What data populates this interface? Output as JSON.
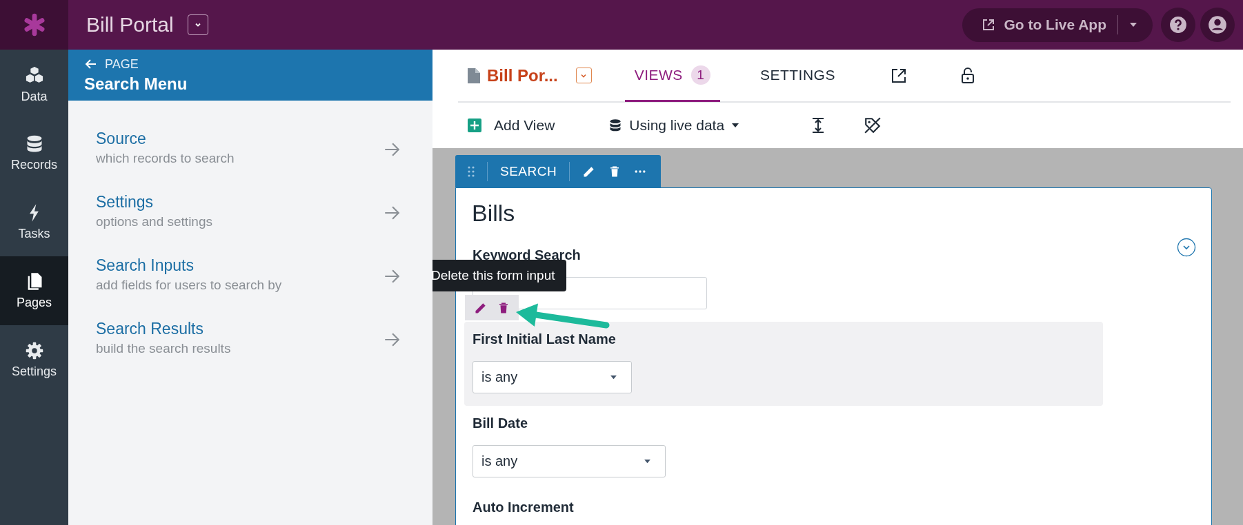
{
  "app": {
    "title": "Bill Portal",
    "live_app_button": "Go to Live App"
  },
  "nav_rail": [
    {
      "label": "Data",
      "kind": "cubes",
      "selected": false
    },
    {
      "label": "Records",
      "kind": "database",
      "selected": false
    },
    {
      "label": "Tasks",
      "kind": "bolt",
      "selected": false
    },
    {
      "label": "Pages",
      "kind": "pages",
      "selected": true
    },
    {
      "label": "Settings",
      "kind": "gear",
      "selected": false
    }
  ],
  "panel": {
    "back_label": "PAGE",
    "title": "Search Menu",
    "items": [
      {
        "title": "Source",
        "subtitle": "which records to search"
      },
      {
        "title": "Settings",
        "subtitle": "options and settings"
      },
      {
        "title": "Search Inputs",
        "subtitle": "add fields for users to search by"
      },
      {
        "title": "Search Results",
        "subtitle": "build the search results"
      }
    ]
  },
  "page_tabs": {
    "page_name": "Bill Por...",
    "tabs": [
      {
        "label": "VIEWS",
        "badge": "1",
        "selected": true
      },
      {
        "label": "SETTINGS",
        "selected": false
      }
    ]
  },
  "toolbar": {
    "add_view": "Add View",
    "data_mode": "Using live data"
  },
  "view": {
    "tag": "SEARCH",
    "title": "Bills",
    "tooltip": "Delete this form input",
    "fields": [
      {
        "label": "Keyword Search",
        "kind": "text",
        "highlighted": false
      },
      {
        "label": "First Initial Last Name",
        "kind": "select",
        "value": "is any",
        "highlighted": true
      },
      {
        "label": "Bill Date",
        "kind": "select",
        "value": "is any",
        "highlighted": false
      },
      {
        "label": "Auto Increment",
        "kind": "label",
        "highlighted": false
      }
    ]
  }
}
